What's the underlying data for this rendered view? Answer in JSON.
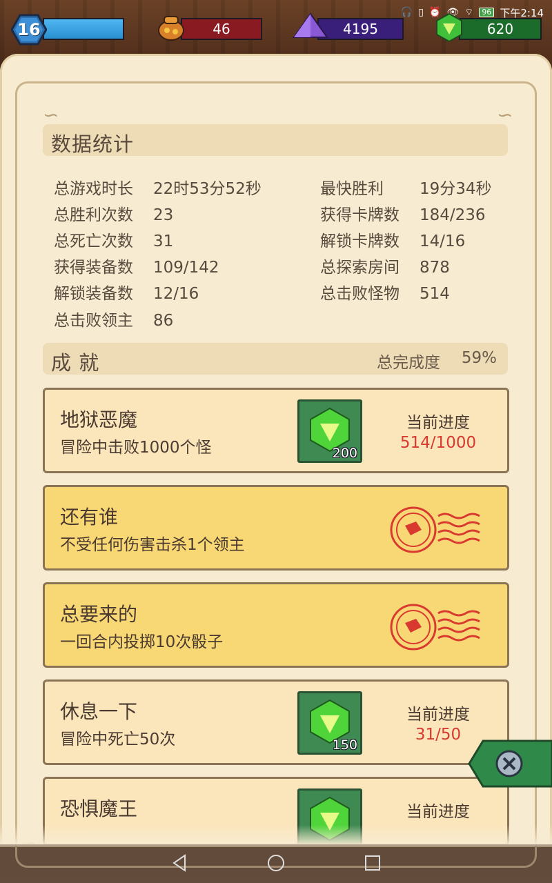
{
  "status_bar": {
    "time": "下午2:14",
    "battery": "96",
    "icons": [
      "headset-icon",
      "vibrate-icon",
      "alarm-icon",
      "eye-icon",
      "wifi-icon",
      "battery-icon"
    ]
  },
  "hud": {
    "level": "16",
    "xp_fraction": 1.0,
    "gold": "46",
    "crystal": "4195",
    "gems": "620"
  },
  "stats_section": {
    "title": "数据统计",
    "left": [
      {
        "label": "总游戏时长",
        "value": "22时53分52秒"
      },
      {
        "label": "总胜利次数",
        "value": "23"
      },
      {
        "label": "总死亡次数",
        "value": "31"
      },
      {
        "label": "获得装备数",
        "value": "109/142"
      },
      {
        "label": "解锁装备数",
        "value": "12/16"
      },
      {
        "label": "总击败领主",
        "value": "86"
      }
    ],
    "right": [
      {
        "label": "最快胜利",
        "value": "19分34秒"
      },
      {
        "label": "获得卡牌数",
        "value": "184/236"
      },
      {
        "label": "解锁卡牌数",
        "value": "14/16"
      },
      {
        "label": "总探索房间",
        "value": "878"
      },
      {
        "label": "总击败怪物",
        "value": "514"
      }
    ]
  },
  "achievements_section": {
    "title": "成 就",
    "completion_label": "总完成度",
    "completion_value": "59%"
  },
  "achievements": [
    {
      "title": "地狱恶魔",
      "desc": "冒险中击败1000个怪",
      "state": "in_progress",
      "reward": "200",
      "progress_label": "当前进度",
      "progress": "514/1000"
    },
    {
      "title": "还有谁",
      "desc": "不受任何伤害击杀1个领主",
      "state": "completed"
    },
    {
      "title": "总要来的",
      "desc": "一回合内投掷10次骰子",
      "state": "completed"
    },
    {
      "title": "休息一下",
      "desc": "冒险中死亡50次",
      "state": "in_progress",
      "reward": "150",
      "progress_label": "当前进度",
      "progress": "31/50"
    },
    {
      "title": "恐惧魔王",
      "desc": "",
      "state": "in_progress",
      "reward": "",
      "progress_label": "当前进度",
      "progress": ""
    }
  ],
  "colors": {
    "parchment": "#f7ecd2",
    "card_normal": "#fbe6bc",
    "card_done": "#f8d775",
    "progress_red": "#d83a30",
    "reward_bg": "#3f8a52",
    "close_tab": "#2f8a4a"
  }
}
